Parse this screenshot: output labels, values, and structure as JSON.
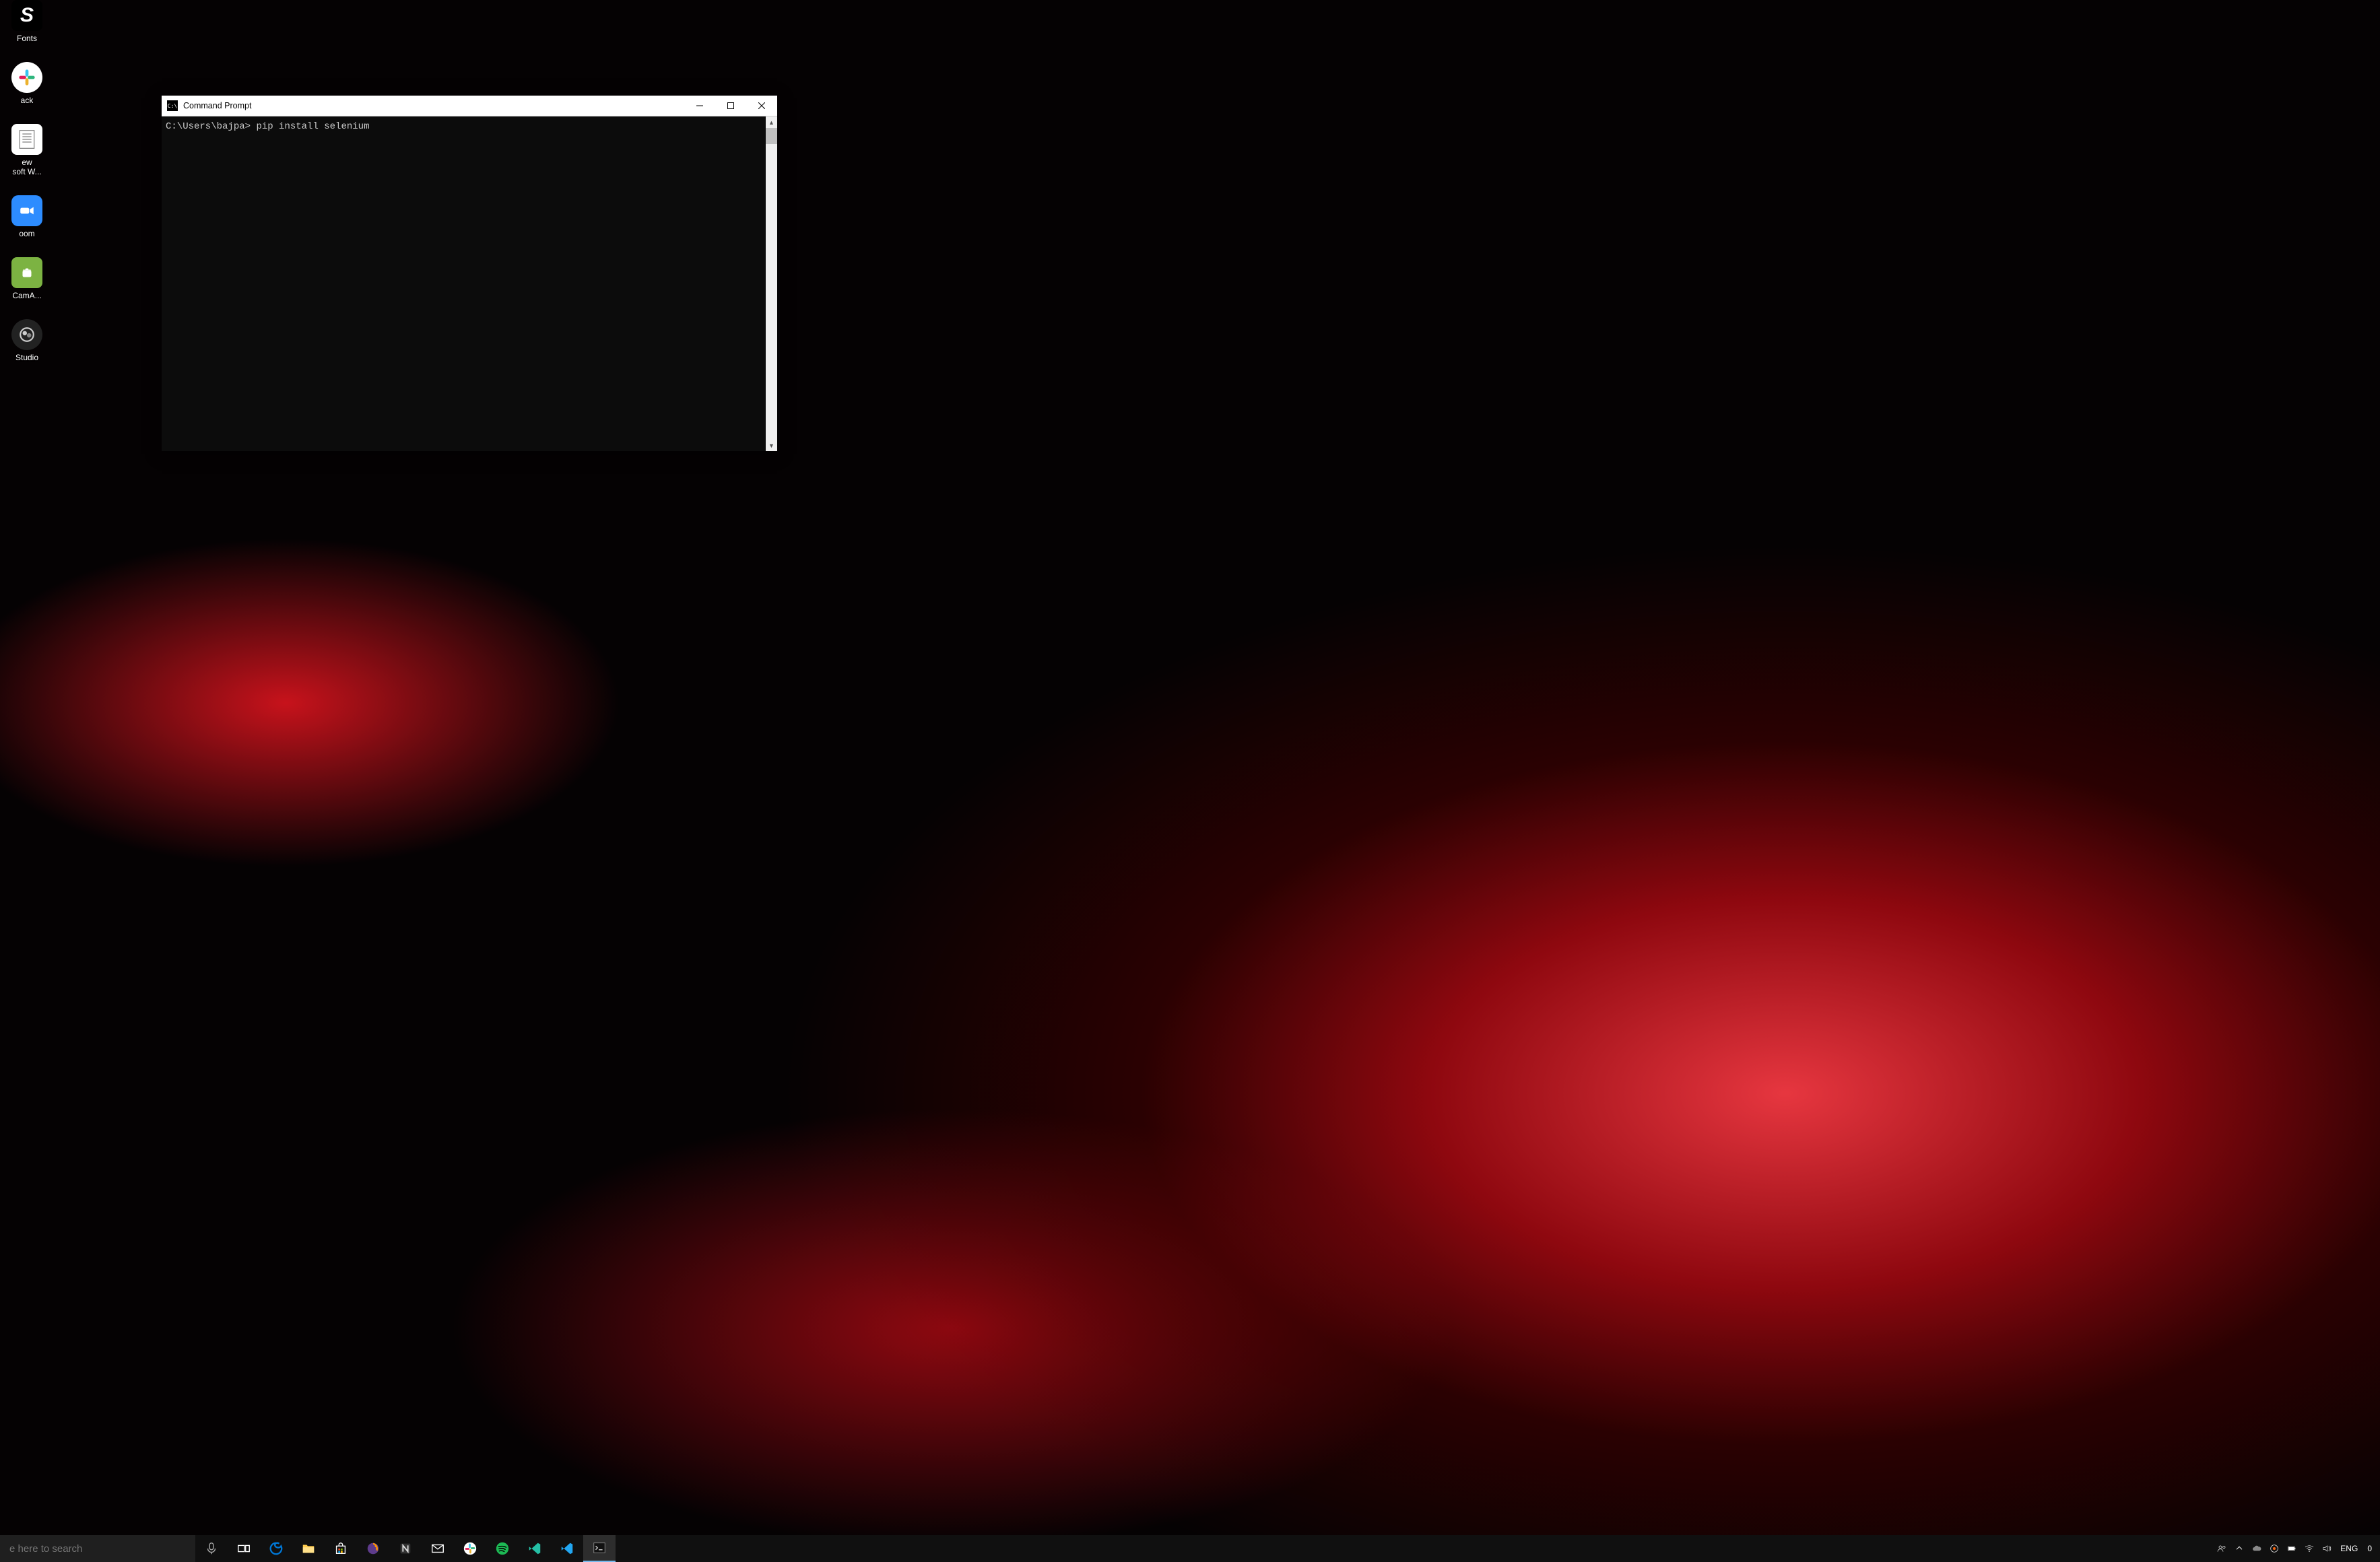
{
  "desktop": {
    "icons": [
      {
        "name": "fonts",
        "label": "Fonts"
      },
      {
        "name": "slack",
        "label": "ack"
      },
      {
        "name": "word",
        "label": "ew\nsoft W..."
      },
      {
        "name": "zoom",
        "label": "oom"
      },
      {
        "name": "camapp",
        "label": "CamA..."
      },
      {
        "name": "studio",
        "label": "Studio"
      }
    ]
  },
  "cmd": {
    "title": "Command Prompt",
    "icon_text": "C:\\",
    "prompt": "C:\\Users\\bajpa>",
    "command": "pip install selenium"
  },
  "taskbar": {
    "search_placeholder": "e here to search",
    "apps": [
      {
        "name": "task-view",
        "color": "#fff"
      },
      {
        "name": "edge",
        "color": "#0078d7"
      },
      {
        "name": "file-explorer",
        "color": "#ffcc4d"
      },
      {
        "name": "microsoft-store",
        "color": "#fff"
      },
      {
        "name": "firefox",
        "color": "#ff9500"
      },
      {
        "name": "notion",
        "color": "#888"
      },
      {
        "name": "mail",
        "color": "#fff"
      },
      {
        "name": "slack",
        "color": "#e01e5a"
      },
      {
        "name": "spotify",
        "color": "#1db954"
      },
      {
        "name": "vscode-insiders",
        "color": "#24bfa5"
      },
      {
        "name": "vscode",
        "color": "#22a7f2"
      },
      {
        "name": "command-prompt",
        "color": "#ccc",
        "active": true
      }
    ],
    "tray": {
      "lang": "ENG",
      "clock": "0"
    }
  }
}
